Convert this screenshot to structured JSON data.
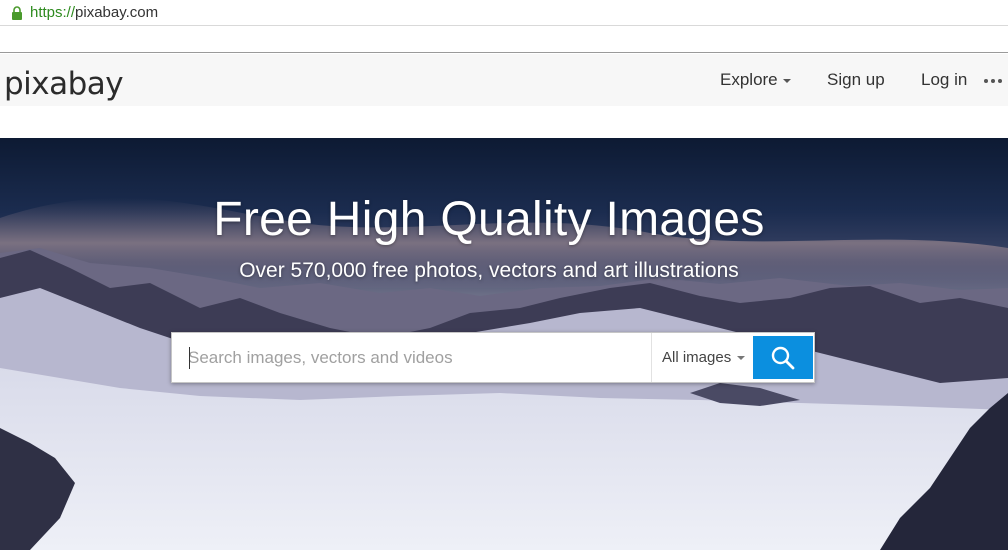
{
  "browser": {
    "url_scheme": "https://",
    "url_host": "pixabay.com"
  },
  "header": {
    "logo": "pixabay",
    "nav": {
      "explore": "Explore",
      "signup": "Sign up",
      "login": "Log in"
    }
  },
  "hero": {
    "title": "Free High Quality Images",
    "subtitle": "Over 570,000 free photos, vectors and art illustrations"
  },
  "search": {
    "placeholder": "Search images, vectors and videos",
    "type_selected": "All images"
  },
  "colors": {
    "search_button": "#0b8fdf",
    "lock": "#4a9a2c"
  },
  "icons": {
    "lock": "lock-icon",
    "more": "more-icon",
    "search": "search-icon"
  }
}
